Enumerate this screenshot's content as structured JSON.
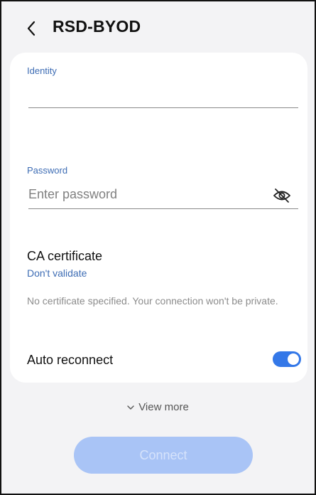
{
  "header": {
    "title": "RSD-BYOD"
  },
  "identity": {
    "label": "Identity",
    "value": ""
  },
  "password": {
    "label": "Password",
    "placeholder": "Enter password",
    "value": ""
  },
  "ca_certificate": {
    "title": "CA certificate",
    "value": "Don't validate",
    "note": "No certificate specified. Your connection won't be private."
  },
  "auto_reconnect": {
    "label": "Auto reconnect",
    "enabled": true
  },
  "view_more": {
    "label": "View more"
  },
  "connect": {
    "label": "Connect",
    "enabled": false
  },
  "colors": {
    "accent": "#3478e8",
    "link": "#3d6cb4",
    "connect_disabled": "#a9c4f6"
  },
  "icons": {
    "back": "chevron-left-icon",
    "password_visibility": "eye-off-icon",
    "view_more": "chevron-down-icon"
  }
}
